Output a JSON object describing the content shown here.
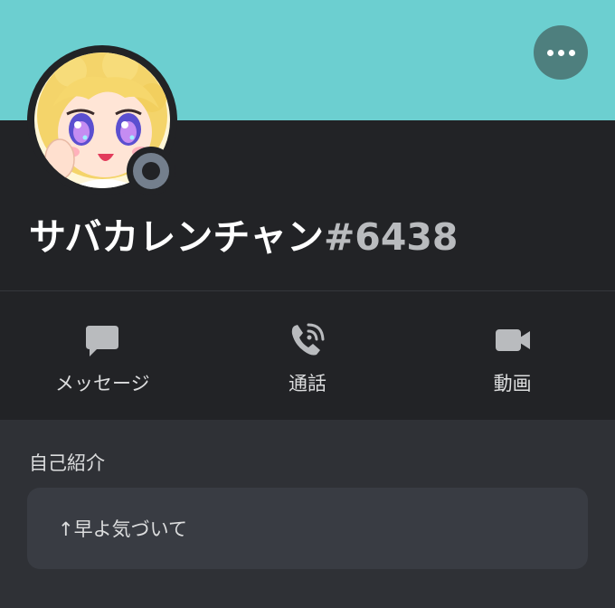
{
  "profile": {
    "display_name": "サバカレンチャン",
    "tag": "#6438",
    "status": "offline"
  },
  "actions": [
    {
      "label": "メッセージ",
      "icon": "message-icon"
    },
    {
      "label": "通話",
      "icon": "phone-call-icon"
    },
    {
      "label": "動画",
      "icon": "video-camera-icon"
    }
  ],
  "about": {
    "title": "自己紹介",
    "bio": "↑早よ気づいて"
  },
  "colors": {
    "banner": "#6ccfd0",
    "header_bg": "#222326",
    "page_bg": "#2f3136",
    "bio_bg": "#393c43",
    "status_offline": "#747f8d"
  }
}
